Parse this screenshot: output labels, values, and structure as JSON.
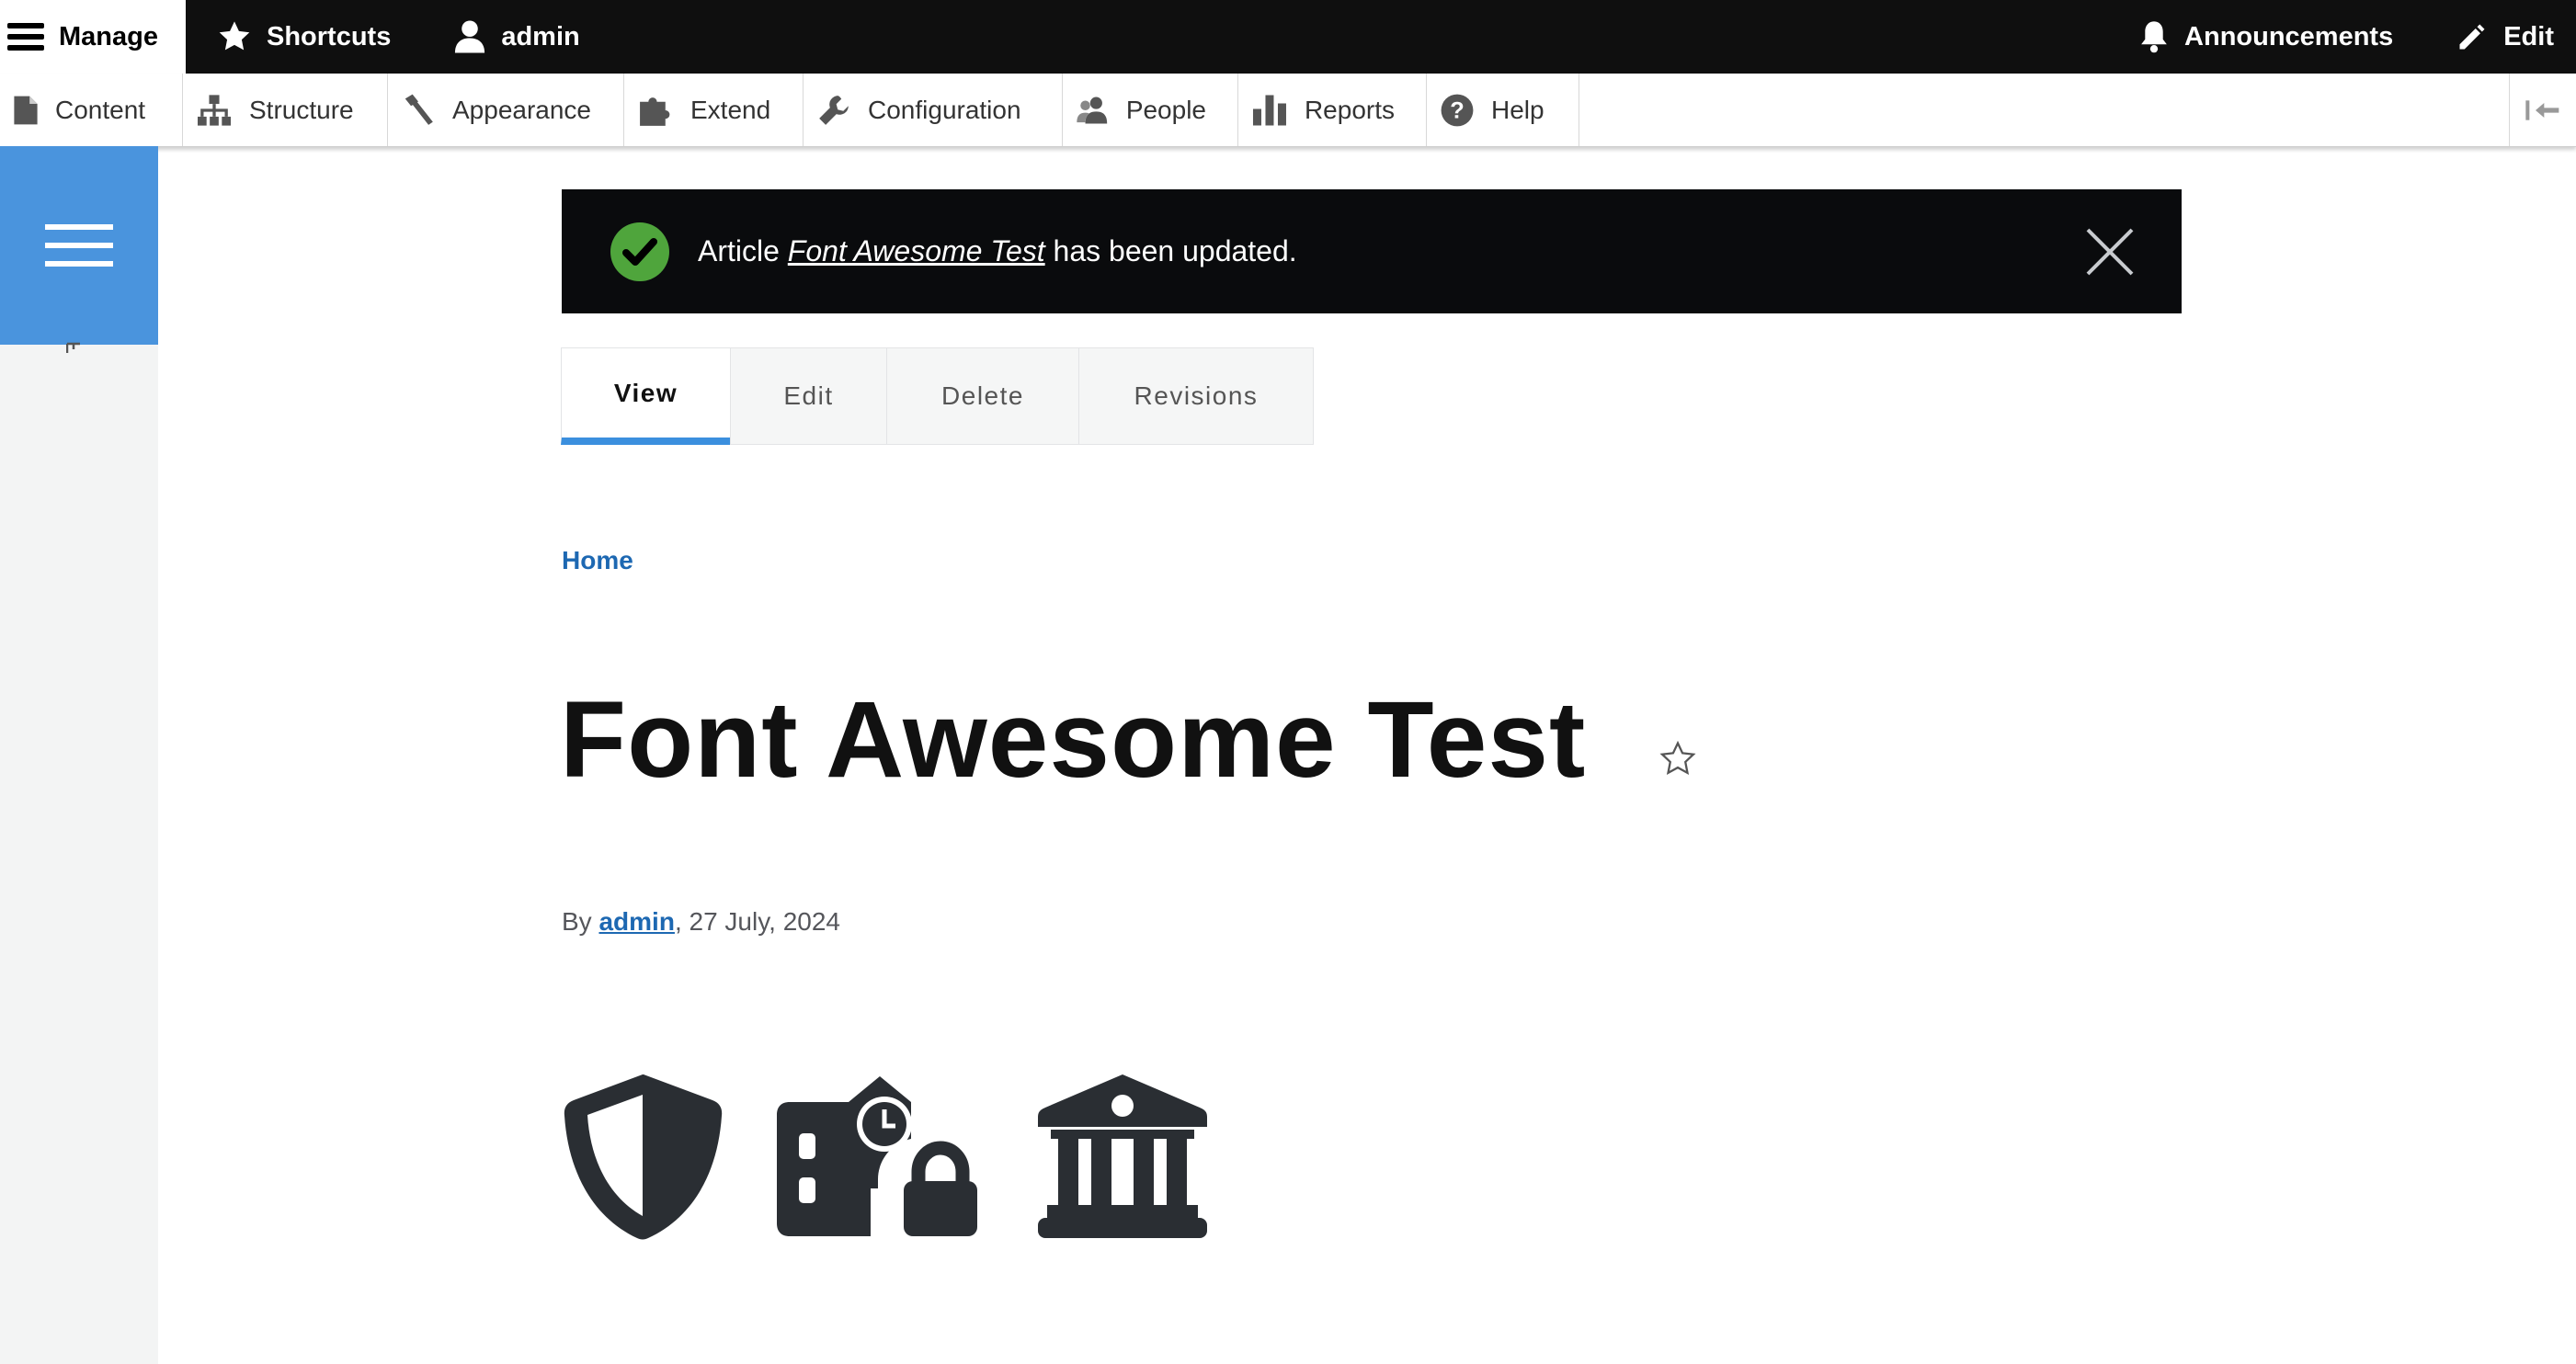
{
  "toolbar": {
    "manage_label": "Manage",
    "shortcuts_label": "Shortcuts",
    "user_label": "admin",
    "announcements_label": "Announcements",
    "edit_label": "Edit"
  },
  "tray": {
    "items": [
      {
        "label": "Content",
        "icon": "file-icon"
      },
      {
        "label": "Structure",
        "icon": "sitemap-icon"
      },
      {
        "label": "Appearance",
        "icon": "paintbrush-icon"
      },
      {
        "label": "Extend",
        "icon": "puzzle-icon"
      },
      {
        "label": "Configuration",
        "icon": "wrench-icon"
      },
      {
        "label": "People",
        "icon": "people-icon"
      },
      {
        "label": "Reports",
        "icon": "bar-chart-icon"
      },
      {
        "label": "Help",
        "icon": "help-icon"
      }
    ]
  },
  "message": {
    "prefix": "Article",
    "link": "Font Awesome Test",
    "suffix": "has been updated.",
    "status_color": "#4fa53c"
  },
  "tabs": [
    {
      "label": "View",
      "active": true
    },
    {
      "label": "Edit",
      "active": false
    },
    {
      "label": "Delete",
      "active": false
    },
    {
      "label": "Revisions",
      "active": false
    }
  ],
  "breadcrumb": {
    "home": "Home"
  },
  "page": {
    "title": "Font Awesome Test",
    "byline_prefix": "By",
    "author": "admin",
    "date": ", 27 July, 2024"
  },
  "content_icons": [
    "shield-halved-icon",
    "building-lock-icon",
    "building-columns-icon"
  ],
  "colors": {
    "accent": "#3b8fde",
    "toolbar": "#0f0f0f",
    "link": "#1d68b2"
  }
}
